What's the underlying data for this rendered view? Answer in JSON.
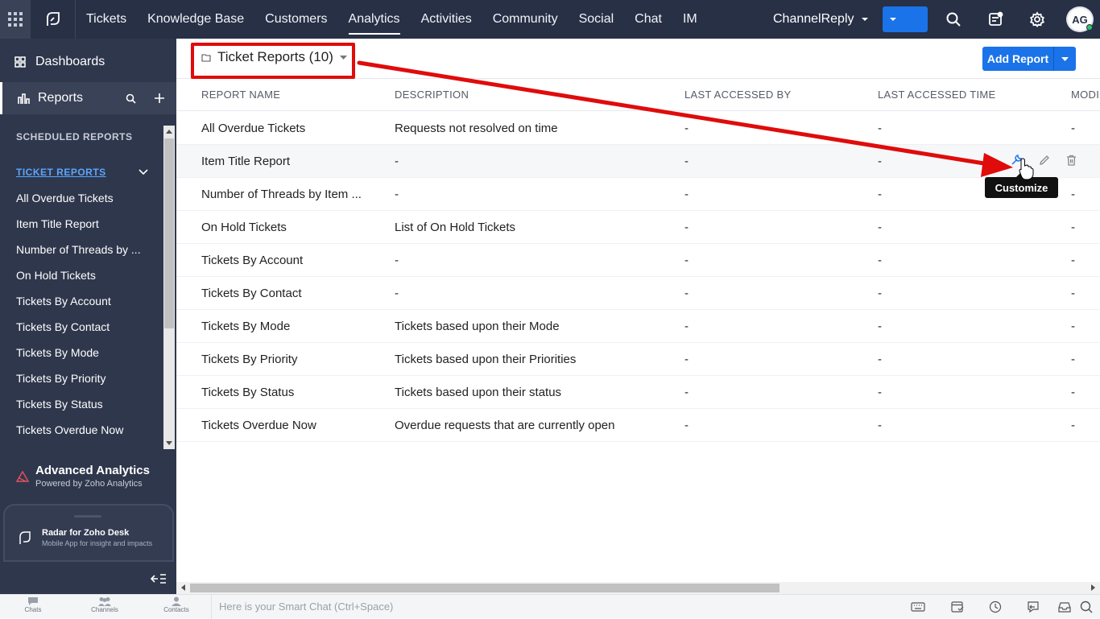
{
  "topnav": {
    "items": [
      "Tickets",
      "Knowledge Base",
      "Customers",
      "Analytics",
      "Activities",
      "Community",
      "Social",
      "Chat",
      "IM"
    ],
    "active": "Analytics",
    "department": "ChannelReply",
    "avatar_initials": "AG"
  },
  "sidebar": {
    "dashboards": "Dashboards",
    "reports": "Reports",
    "scheduled": "SCHEDULED REPORTS",
    "ticket_reports": "TICKET REPORTS",
    "items": [
      "All Overdue Tickets",
      "Item Title Report",
      "Number of Threads by ...",
      "On Hold Tickets",
      "Tickets By Account",
      "Tickets By Contact",
      "Tickets By Mode",
      "Tickets By Priority",
      "Tickets By Status",
      "Tickets Overdue Now"
    ],
    "advanced_title": "Advanced Analytics",
    "advanced_sub": "Powered by Zoho Analytics",
    "radar_title": "Radar for Zoho Desk",
    "radar_sub": "Mobile App for insight and impacts"
  },
  "main": {
    "folder_title": "Ticket Reports (10)",
    "add_report": "Add Report",
    "columns": [
      "REPORT NAME",
      "DESCRIPTION",
      "LAST ACCESSED BY",
      "LAST ACCESSED TIME",
      "MODI"
    ],
    "rows": [
      {
        "name": "All Overdue Tickets",
        "desc": "Requests not resolved on time",
        "by": "-",
        "time": "-",
        "mod": "-"
      },
      {
        "name": "Item Title Report",
        "desc": "-",
        "by": "-",
        "time": "-",
        "mod": ""
      },
      {
        "name": "Number of Threads by Item ...",
        "desc": "-",
        "by": "-",
        "time": "-",
        "mod": "-"
      },
      {
        "name": "On Hold Tickets",
        "desc": "List of On Hold Tickets",
        "by": "-",
        "time": "-",
        "mod": "-"
      },
      {
        "name": "Tickets By Account",
        "desc": "-",
        "by": "-",
        "time": "-",
        "mod": "-"
      },
      {
        "name": "Tickets By Contact",
        "desc": "-",
        "by": "-",
        "time": "-",
        "mod": "-"
      },
      {
        "name": "Tickets By Mode",
        "desc": "Tickets based upon their Mode",
        "by": "-",
        "time": "-",
        "mod": "-"
      },
      {
        "name": "Tickets By Priority",
        "desc": "Tickets based upon their Priorities",
        "by": "-",
        "time": "-",
        "mod": "-"
      },
      {
        "name": "Tickets By Status",
        "desc": "Tickets based upon their status",
        "by": "-",
        "time": "-",
        "mod": "-"
      },
      {
        "name": "Tickets Overdue Now",
        "desc": "Overdue requests that are currently open",
        "by": "-",
        "time": "-",
        "mod": "-"
      }
    ],
    "tooltip": "Customize"
  },
  "bottom": {
    "chats": "Chats",
    "channels": "Channels",
    "contacts": "Contacts",
    "smartchat_placeholder": "Here is your Smart Chat (Ctrl+Space)"
  },
  "colors": {
    "topbar": "#283046",
    "sidebar": "#2f374c",
    "accent": "#1a73e8",
    "highlight": "#e00b0b"
  },
  "icons": [
    "apps-grid-icon",
    "desk-logo-icon",
    "plus-icon",
    "search-icon",
    "notes-icon",
    "gear-icon",
    "dashboard-icon",
    "reports-icon",
    "customize-wrench-icon",
    "edit-pencil-icon",
    "trash-icon",
    "folder-icon"
  ]
}
